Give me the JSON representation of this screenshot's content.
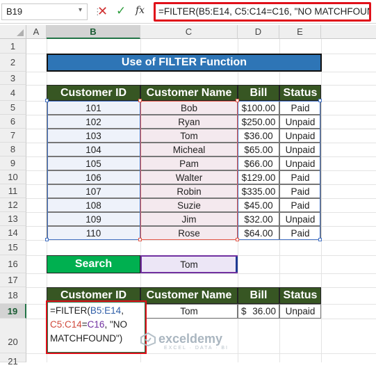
{
  "formula_bar": {
    "name_box": "B19",
    "formula": "=FILTER(B5:E14, C5:C14=C16, \"NO MATCHFOUND\")"
  },
  "columns": [
    "A",
    "B",
    "C",
    "D",
    "E"
  ],
  "rows": [
    "1",
    "2",
    "3",
    "4",
    "5",
    "6",
    "7",
    "8",
    "9",
    "10",
    "11",
    "12",
    "13",
    "14",
    "15",
    "16",
    "17",
    "18",
    "19",
    "20",
    "21"
  ],
  "title": "Use of FILTER Function",
  "table": {
    "headers": [
      "Customer ID",
      "Customer Name",
      "Bill",
      "Status"
    ],
    "rows": [
      {
        "id": "101",
        "name": "Bob",
        "cur": "$100.00",
        "status": "Paid"
      },
      {
        "id": "102",
        "name": "Ryan",
        "cur": "$250.00",
        "status": "Unpaid"
      },
      {
        "id": "103",
        "name": "Tom",
        "cur": "$36.00",
        "status": "Unpaid"
      },
      {
        "id": "104",
        "name": "Micheal",
        "cur": "$65.00",
        "status": "Unpaid"
      },
      {
        "id": "105",
        "name": "Pam",
        "cur": "$66.00",
        "status": "Unpaid"
      },
      {
        "id": "106",
        "name": "Walter",
        "cur": "$129.00",
        "status": "Paid"
      },
      {
        "id": "107",
        "name": "Robin",
        "cur": "$335.00",
        "status": "Paid"
      },
      {
        "id": "108",
        "name": "Suzie",
        "cur": "$45.00",
        "status": "Paid"
      },
      {
        "id": "109",
        "name": "Jim",
        "cur": "$32.00",
        "status": "Unpaid"
      },
      {
        "id": "110",
        "name": "Rose",
        "cur": "$64.00",
        "status": "Paid"
      }
    ]
  },
  "search": {
    "label": "Search",
    "value": "Tom"
  },
  "result": {
    "headers": [
      "Customer ID",
      "Customer Name",
      "Bill",
      "Status"
    ],
    "name": "Tom",
    "bill_symbol": "$",
    "bill_value": "36.00",
    "status": "Unpaid",
    "formula_parts": {
      "p1": "=FILTER(",
      "r1": "B5:E14",
      "p2": ",",
      "r2": "C5:C14",
      "p3": "=",
      "r3": "C16",
      "p4": ", \"NO MATCHFOUND\")"
    }
  },
  "watermark": {
    "name": "exceldemy",
    "tagline": "EXCEL · DATA · BI"
  },
  "colors": {
    "header_green": "#375623",
    "title_blue": "#2e75b6",
    "search_green": "#00b050",
    "highlight_red": "#e0101a"
  }
}
